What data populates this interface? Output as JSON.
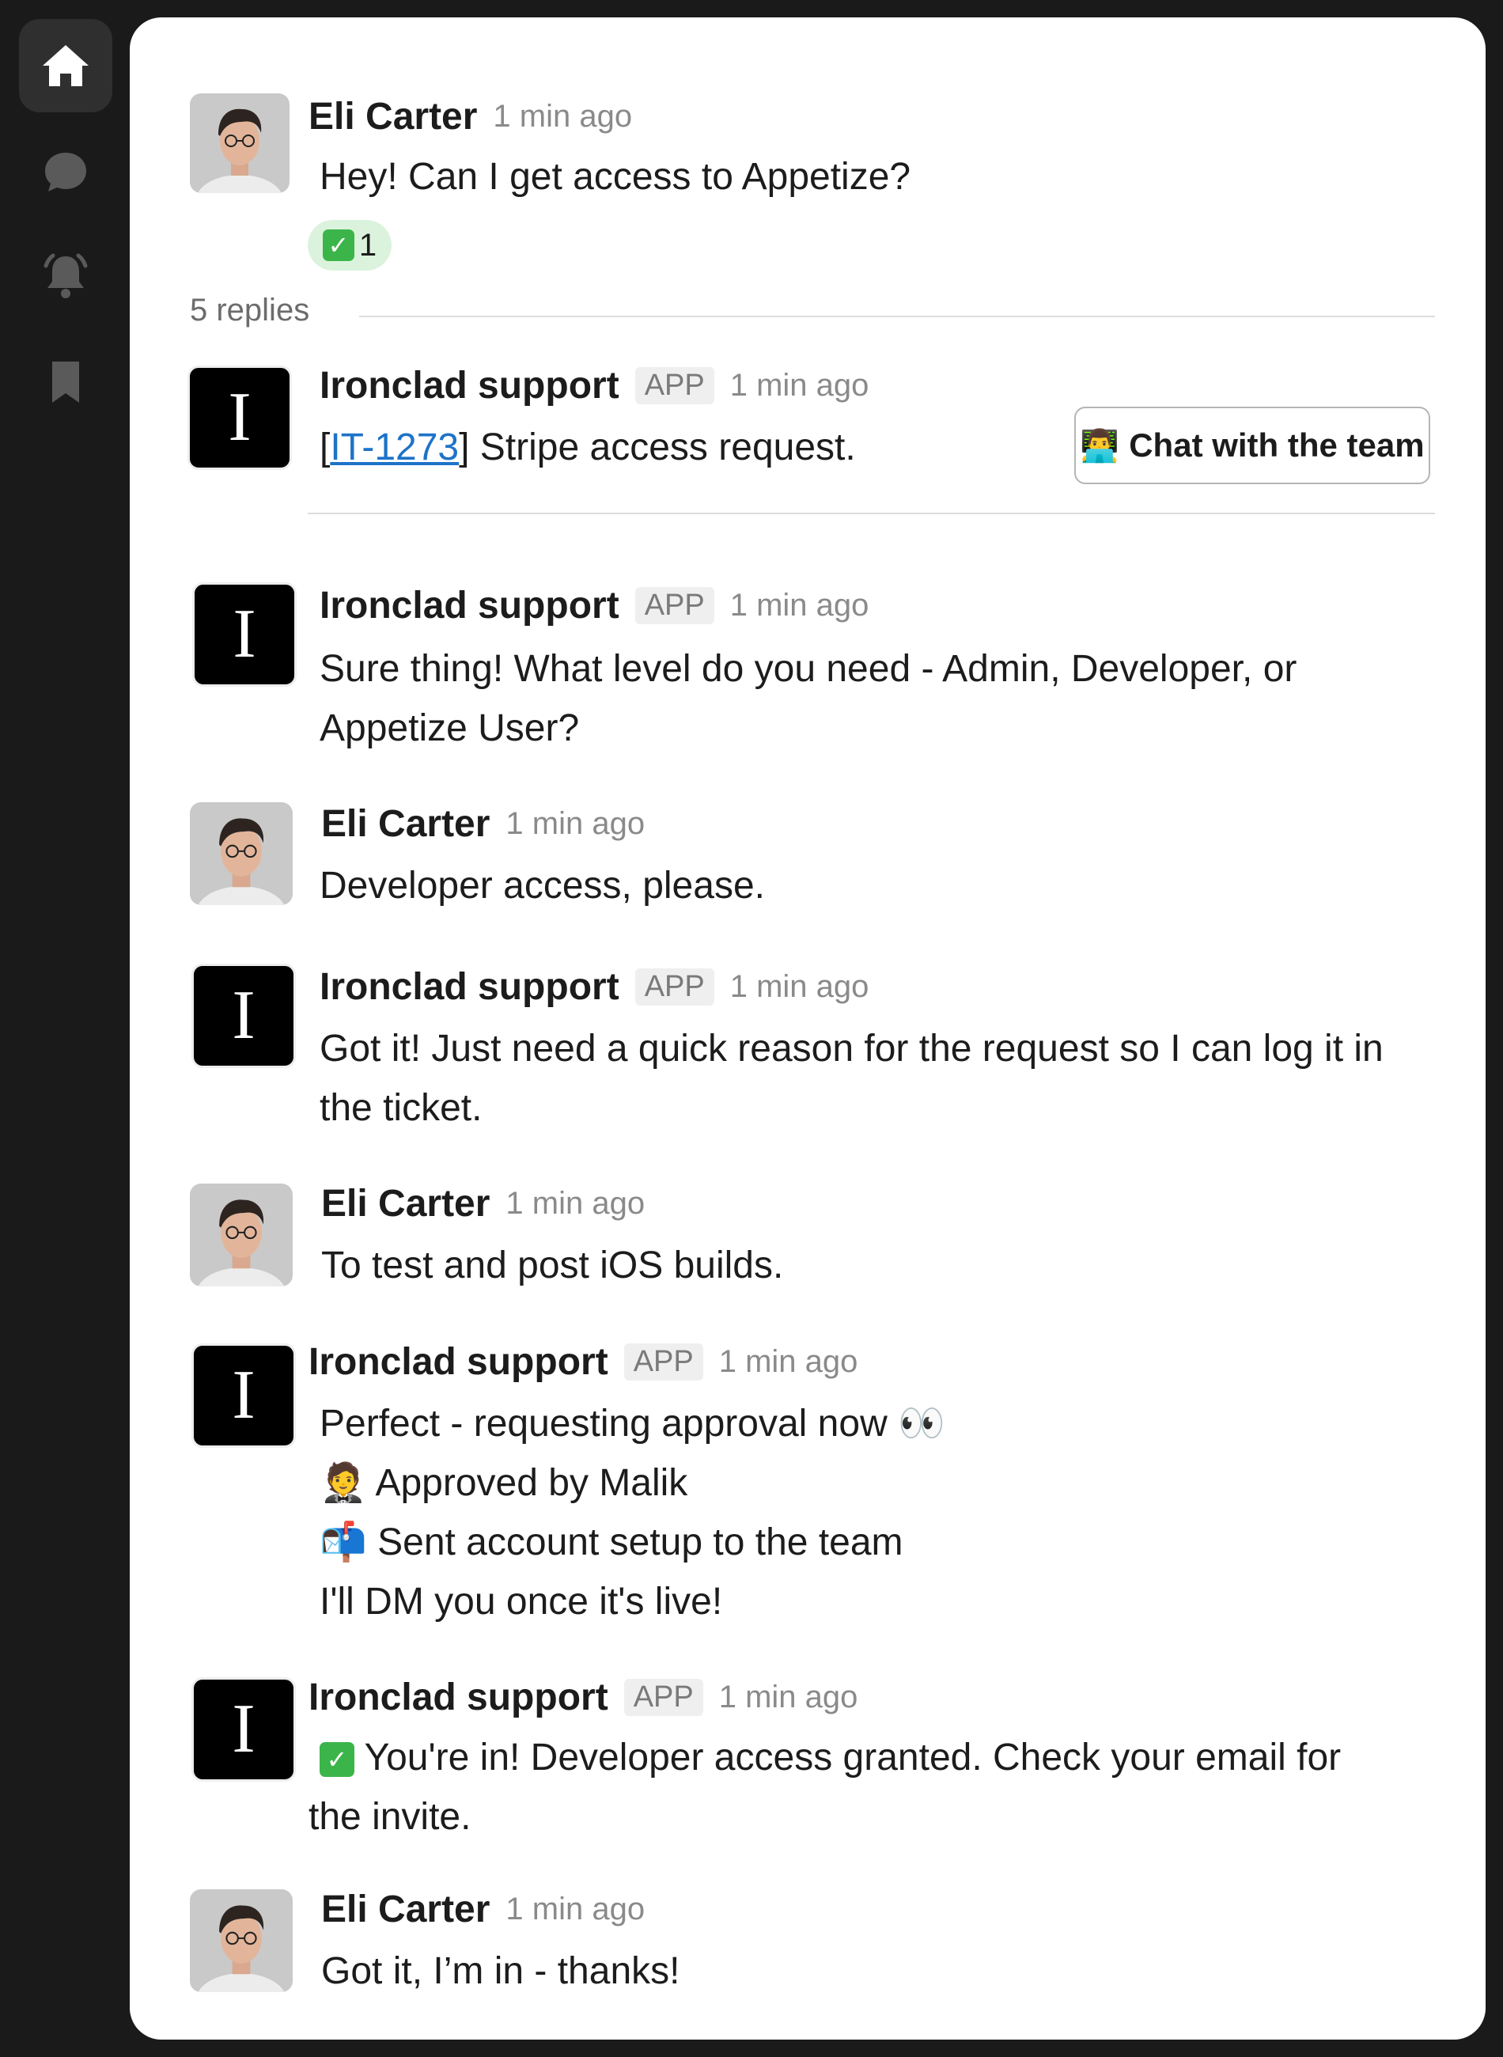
{
  "sidebar": {
    "icons": [
      "home-icon",
      "chat-bubble-icon",
      "bell-icon",
      "bookmark-icon"
    ]
  },
  "thread": {
    "parent": {
      "author": "Eli Carter",
      "time": "1 min ago",
      "text": "Hey! Can I get access to Appetize?",
      "reaction": {
        "emoji": "✅",
        "count": "1"
      }
    },
    "replies_label": "5 replies",
    "ticket_message": {
      "author": "Ironclad support",
      "tag": "APP",
      "time": "1 min ago",
      "ticket_open": "[",
      "ticket_id": "IT-1273",
      "ticket_close": "]",
      "ticket_text": " Stripe access request.",
      "button_emoji": "👨‍💻",
      "button_label": "Chat with the team"
    },
    "messages": [
      {
        "author": "Ironclad support",
        "tag": "APP",
        "time": "1 min ago",
        "lines": [
          "Sure thing! What level do you need - Admin, Developer, or",
          "Appetize User?"
        ]
      },
      {
        "author": "Eli Carter",
        "time": "1 min ago",
        "lines": [
          "Developer access, please."
        ]
      },
      {
        "author": "Ironclad support",
        "tag": "APP",
        "time": "1 min ago",
        "lines": [
          "Got it! Just need a quick reason for the request so I can log it in",
          "the ticket."
        ]
      },
      {
        "author": "Eli Carter",
        "time": "1 min ago",
        "lines": [
          "To test and post iOS builds."
        ]
      },
      {
        "author": "Ironclad support",
        "tag": "APP",
        "time": "1 min ago",
        "lines": [
          "Perfect - requesting approval now 👀",
          "🤵 Approved by Malik",
          "📬 Sent account setup to the team",
          "I'll DM you once it's live!"
        ]
      },
      {
        "author": "Ironclad support",
        "tag": "APP",
        "time": "1 min ago",
        "check": "✅",
        "lines": [
          " You're in! Developer access granted. Check your email for",
          "the invite."
        ]
      },
      {
        "author": "Eli Carter",
        "time": "1 min ago",
        "lines": [
          "Got it, I’m in - thanks!"
        ]
      }
    ],
    "app_avatar_letter": "I"
  }
}
